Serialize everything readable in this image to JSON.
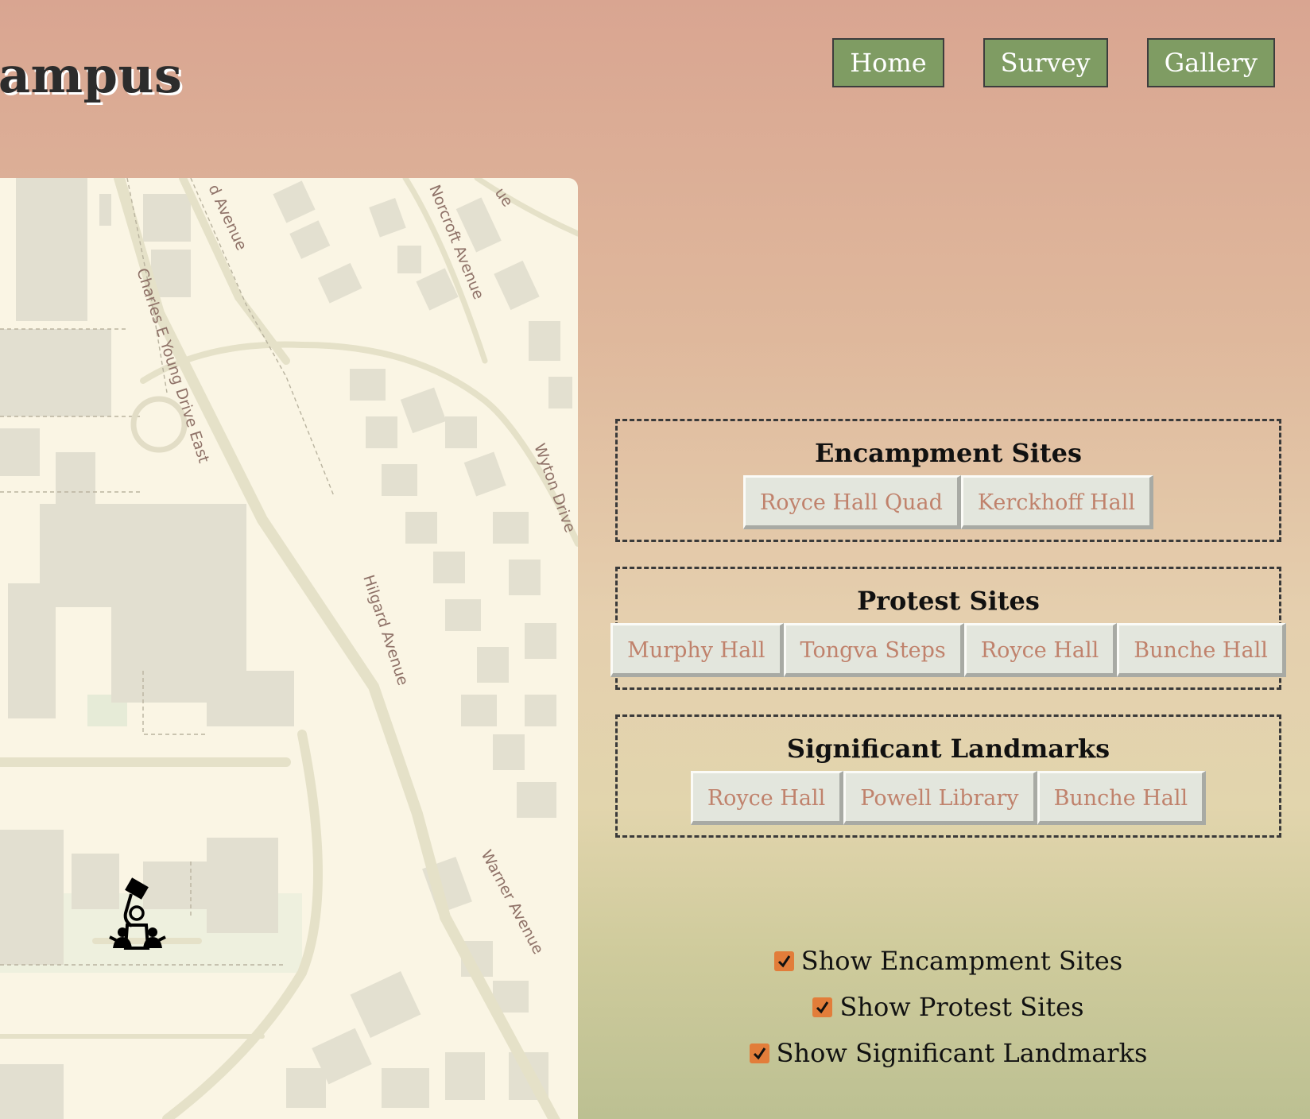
{
  "header": {
    "title": "Campus"
  },
  "nav": {
    "home": "Home",
    "survey": "Survey",
    "gallery": "Gallery"
  },
  "map": {
    "streets": {
      "hilgard_top": "d Avenue",
      "norcroft": "Norcroft Avenue",
      "top_right": "ue",
      "charles_young": "Charles E Young Drive East",
      "wyton": "Wyton Drive",
      "hilgard": "Hilgard Avenue",
      "warner": "Warner Avenue"
    },
    "marker_icon": "protest-marker-icon"
  },
  "panels": {
    "encampment": {
      "title": "Encampment Sites",
      "items": [
        "Royce Hall Quad",
        "Kerckhoff Hall"
      ]
    },
    "protest": {
      "title": "Protest Sites",
      "items": [
        "Murphy Hall",
        "Tongva Steps",
        "Royce Hall",
        "Bunche Hall"
      ]
    },
    "landmarks": {
      "title": "Significant Landmarks",
      "items": [
        "Royce Hall",
        "Powell Library",
        "Bunche Hall"
      ]
    }
  },
  "toggles": {
    "encampment": {
      "label": "Show Encampment Sites",
      "checked": true
    },
    "protest": {
      "label": "Show Protest Sites",
      "checked": true
    },
    "landmarks": {
      "label": "Show Significant Landmarks",
      "checked": true
    }
  },
  "colors": {
    "nav_bg": "#7f9c63",
    "chip_bg": "#e3e6dd",
    "chip_text": "#c0826c",
    "checkbox": "#e27d3a",
    "map_bg": "#faf5e4"
  }
}
